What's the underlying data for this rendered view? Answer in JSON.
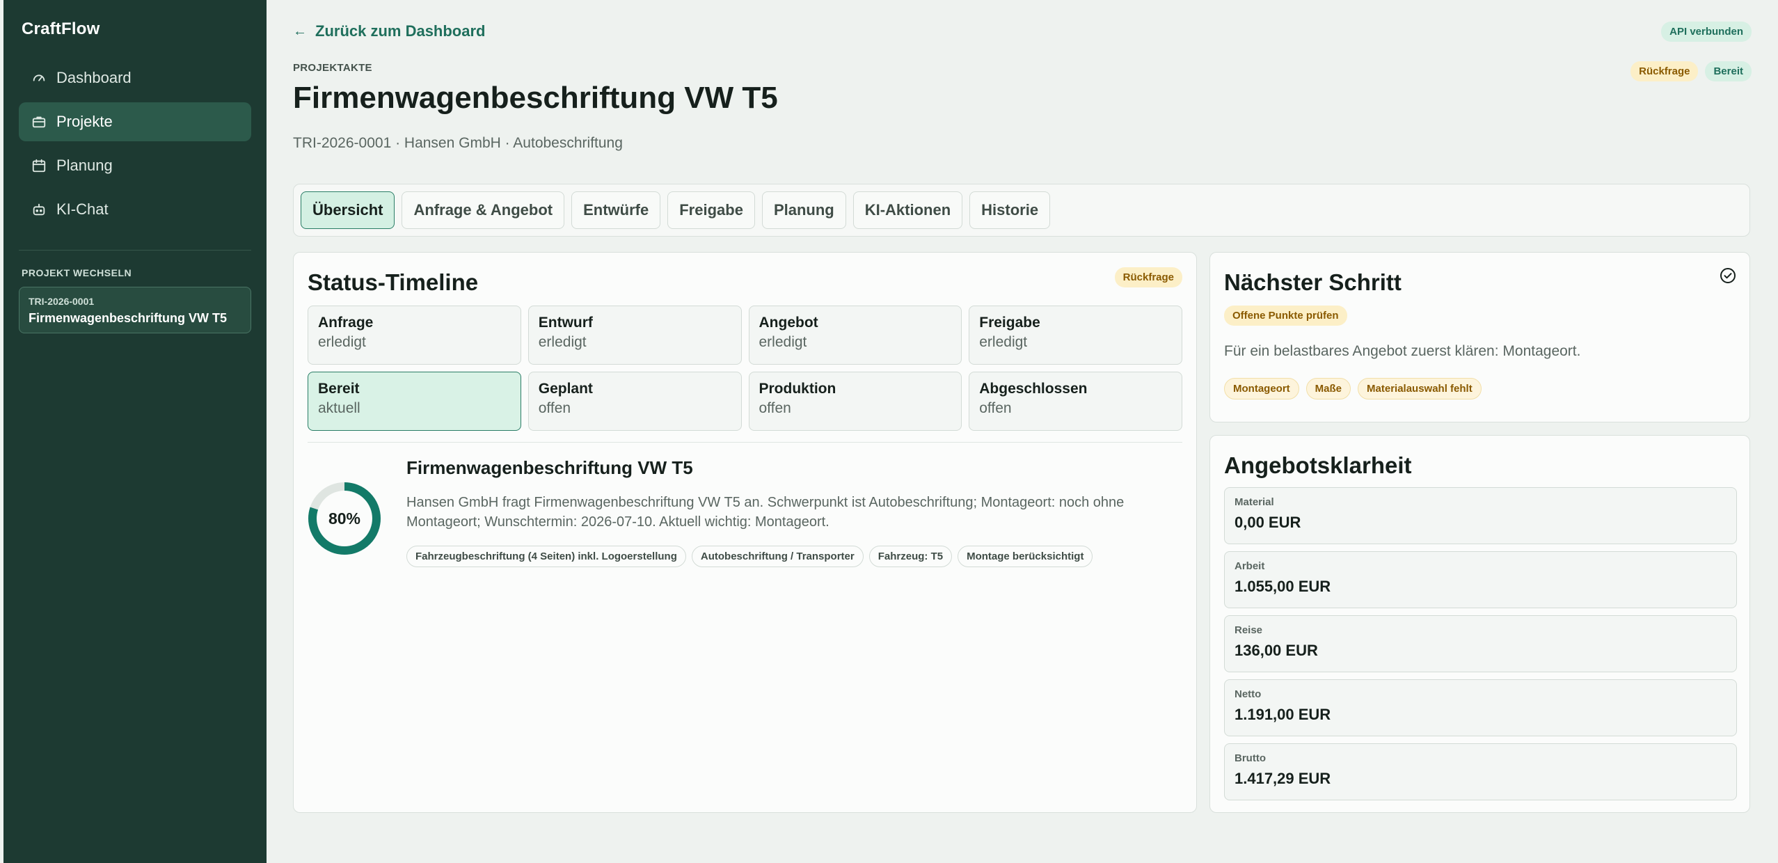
{
  "app": {
    "name": "CraftFlow"
  },
  "sidebar": {
    "items": [
      {
        "label": "Dashboard",
        "icon": "gauge-icon",
        "active": false
      },
      {
        "label": "Projekte",
        "icon": "briefcase-icon",
        "active": true
      },
      {
        "label": "Planung",
        "icon": "calendar-icon",
        "active": false
      },
      {
        "label": "KI-Chat",
        "icon": "robot-icon",
        "active": false
      }
    ],
    "switch_title": "PROJEKT WECHSELN",
    "project": {
      "id": "TRI-2026-0001",
      "name": "Firmenwagenbeschriftung VW T5"
    }
  },
  "header": {
    "back_label": "Zurück zum Dashboard",
    "api_status": "API verbunden",
    "eyebrow": "PROJEKTAKTE",
    "title": "Firmenwagenbeschriftung VW T5",
    "subtitle": "TRI-2026-0001 · Hansen GmbH · Autobeschriftung",
    "badges": [
      "Rückfrage",
      "Bereit"
    ]
  },
  "tabs": [
    {
      "label": "Übersicht",
      "active": true
    },
    {
      "label": "Anfrage & Angebot",
      "active": false
    },
    {
      "label": "Entwürfe",
      "active": false
    },
    {
      "label": "Freigabe",
      "active": false
    },
    {
      "label": "Planung",
      "active": false
    },
    {
      "label": "KI-Aktionen",
      "active": false
    },
    {
      "label": "Historie",
      "active": false
    }
  ],
  "timeline": {
    "title": "Status-Timeline",
    "badge": "Rückfrage",
    "stages": [
      {
        "name": "Anfrage",
        "state": "erledigt"
      },
      {
        "name": "Entwurf",
        "state": "erledigt"
      },
      {
        "name": "Angebot",
        "state": "erledigt"
      },
      {
        "name": "Freigabe",
        "state": "erledigt"
      },
      {
        "name": "Bereit",
        "state": "aktuell"
      },
      {
        "name": "Geplant",
        "state": "offen"
      },
      {
        "name": "Produktion",
        "state": "offen"
      },
      {
        "name": "Abgeschlossen",
        "state": "offen"
      }
    ],
    "progress": 80,
    "progress_label": "80%",
    "summary_title": "Firmenwagenbeschriftung VW T5",
    "summary_text": "Hansen GmbH fragt Firmenwagenbeschriftung VW T5 an. Schwerpunkt ist Autobeschriftung; Montageort: noch ohne Montageort; Wunschtermin: 2026-07-10. Aktuell wichtig: Montageort.",
    "chips": [
      "Fahrzeugbeschriftung (4 Seiten) inkl. Logoerstellung",
      "Autobeschriftung / Transporter",
      "Fahrzeug: T5",
      "Montage berücksichtigt"
    ]
  },
  "next_step": {
    "title": "Nächster Schritt",
    "badge": "Offene Punkte prüfen",
    "text": "Für ein belastbares Angebot zuerst klären: Montageort.",
    "chips": [
      "Montageort",
      "Maße",
      "Materialauswahl fehlt"
    ]
  },
  "offer": {
    "title": "Angebotsklarheit",
    "rows": [
      {
        "label": "Material",
        "value": "0,00 EUR"
      },
      {
        "label": "Arbeit",
        "value": "1.055,00 EUR"
      },
      {
        "label": "Reise",
        "value": "136,00 EUR"
      },
      {
        "label": "Netto",
        "value": "1.191,00 EUR"
      },
      {
        "label": "Brutto",
        "value": "1.417,29 EUR"
      }
    ]
  },
  "colors": {
    "sidebar_bg": "#1d3a32",
    "accent": "#1f6f5c",
    "ring": "#137a68",
    "ring_track": "#dfe5e1",
    "warn_bg": "#fcefc7",
    "ok_bg": "#d7f0e4"
  }
}
